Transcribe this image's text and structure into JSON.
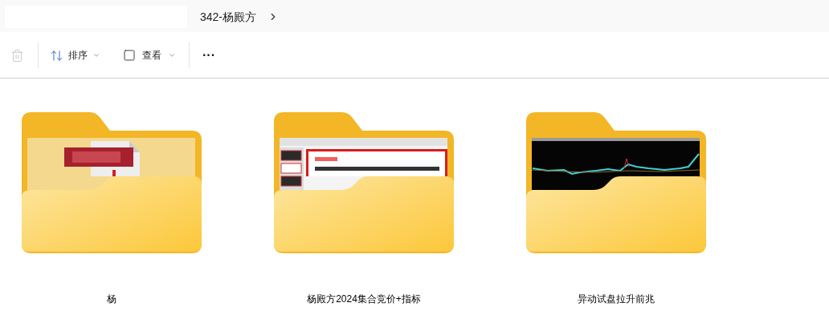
{
  "address_bar": {
    "breadcrumb": "342-杨殿方"
  },
  "toolbar": {
    "sort": "排序",
    "view": "查看",
    "more": "···"
  },
  "folders": [
    {
      "name": "杨",
      "kind": "pdf"
    },
    {
      "name": "杨殿方2024集合竞价+指标",
      "kind": "document"
    },
    {
      "name": "异动试盘拉升前兆",
      "kind": "chart"
    }
  ]
}
